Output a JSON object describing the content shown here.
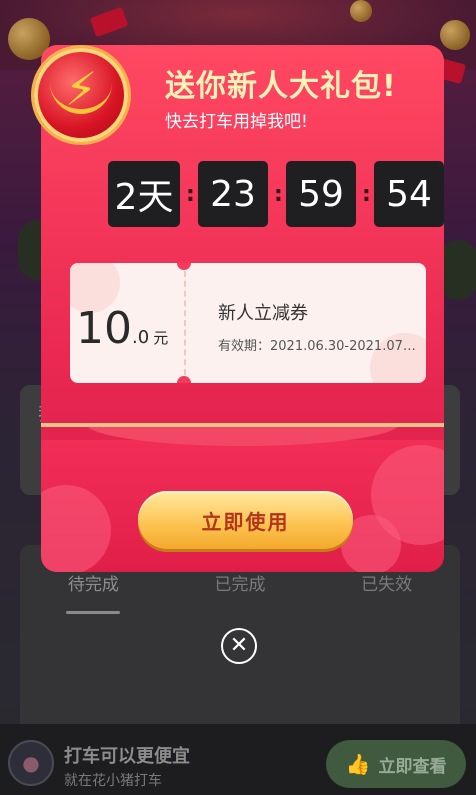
{
  "background": {
    "card_text": "我",
    "tabs": [
      "待完成",
      "已完成",
      "已失效"
    ]
  },
  "promo": {
    "title": "打车可以更便宜",
    "subtitle": "就在花小猪打车",
    "button_label": "立即查看",
    "avatar_icon": "pig-icon"
  },
  "modal": {
    "badge_icon": "lightning-bolt-icon",
    "title": "送你新人大礼包!",
    "subtitle": "快去打车用掉我吧!",
    "countdown": {
      "days": "2天",
      "hours": "23",
      "minutes": "59",
      "seconds": "54"
    },
    "coupon": {
      "amount_int": "10",
      "amount_dec": ".0",
      "unit": "元",
      "name": "新人立减券",
      "validity": "有效期：2021.06.30-2021.07.…"
    },
    "cta_label": "立即使用",
    "close_icon": "close-circle-icon"
  },
  "colors": {
    "modal_red": "#ea2852",
    "title_yellow": "#fff3b8",
    "button_gold": "#fcc24e",
    "button_text": "#b2341a"
  }
}
